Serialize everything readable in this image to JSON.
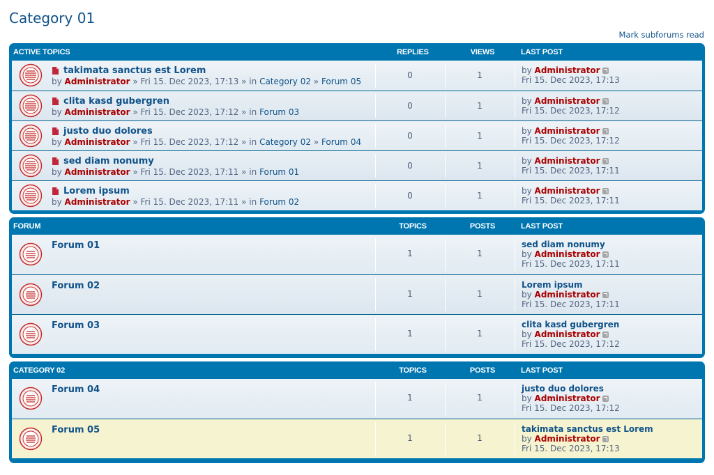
{
  "page": {
    "title": "Category 01",
    "mark_read": "Mark subforums read"
  },
  "active": {
    "header": {
      "title": "ACTIVE TOPICS",
      "col1": "REPLIES",
      "col2": "VIEWS",
      "col3": "LAST POST"
    },
    "rows": [
      {
        "title": "takimata sanctus est Lorem",
        "by": "by",
        "author": "Administrator",
        "sep": "»",
        "date": "Fri 15. Dec 2023, 17:13",
        "in": "» in",
        "path": [
          "Category 02",
          "Forum 05"
        ],
        "replies": "0",
        "views": "1",
        "lp_by": "by",
        "lp_author": "Administrator",
        "lp_date": "Fri 15. Dec 2023, 17:13"
      },
      {
        "title": "clita kasd gubergren",
        "by": "by",
        "author": "Administrator",
        "sep": "»",
        "date": "Fri 15. Dec 2023, 17:12",
        "in": "» in",
        "path": [
          "Forum 03"
        ],
        "replies": "0",
        "views": "1",
        "lp_by": "by",
        "lp_author": "Administrator",
        "lp_date": "Fri 15. Dec 2023, 17:12"
      },
      {
        "title": "justo duo dolores",
        "by": "by",
        "author": "Administrator",
        "sep": "»",
        "date": "Fri 15. Dec 2023, 17:12",
        "in": "» in",
        "path": [
          "Category 02",
          "Forum 04"
        ],
        "replies": "0",
        "views": "1",
        "lp_by": "by",
        "lp_author": "Administrator",
        "lp_date": "Fri 15. Dec 2023, 17:12"
      },
      {
        "title": "sed diam nonumy",
        "by": "by",
        "author": "Administrator",
        "sep": "»",
        "date": "Fri 15. Dec 2023, 17:11",
        "in": "» in",
        "path": [
          "Forum 01"
        ],
        "replies": "0",
        "views": "1",
        "lp_by": "by",
        "lp_author": "Administrator",
        "lp_date": "Fri 15. Dec 2023, 17:11"
      },
      {
        "title": "Lorem ipsum",
        "by": "by",
        "author": "Administrator",
        "sep": "»",
        "date": "Fri 15. Dec 2023, 17:11",
        "in": "» in",
        "path": [
          "Forum 02"
        ],
        "replies": "0",
        "views": "1",
        "lp_by": "by",
        "lp_author": "Administrator",
        "lp_date": "Fri 15. Dec 2023, 17:11"
      }
    ]
  },
  "forum": {
    "header": {
      "title": "FORUM",
      "col1": "TOPICS",
      "col2": "POSTS",
      "col3": "LAST POST"
    },
    "rows": [
      {
        "name": "Forum 01",
        "topics": "1",
        "posts": "1",
        "lp_title": "sed diam nonumy",
        "lp_by": "by",
        "lp_author": "Administrator",
        "lp_date": "Fri 15. Dec 2023, 17:11"
      },
      {
        "name": "Forum 02",
        "topics": "1",
        "posts": "1",
        "lp_title": "Lorem ipsum",
        "lp_by": "by",
        "lp_author": "Administrator",
        "lp_date": "Fri 15. Dec 2023, 17:11"
      },
      {
        "name": "Forum 03",
        "topics": "1",
        "posts": "1",
        "lp_title": "clita kasd gubergren",
        "lp_by": "by",
        "lp_author": "Administrator",
        "lp_date": "Fri 15. Dec 2023, 17:12"
      }
    ]
  },
  "category2": {
    "header": {
      "title": "CATEGORY 02",
      "col1": "TOPICS",
      "col2": "POSTS",
      "col3": "LAST POST"
    },
    "rows": [
      {
        "name": "Forum 04",
        "topics": "1",
        "posts": "1",
        "lp_title": "justo duo dolores",
        "lp_by": "by",
        "lp_author": "Administrator",
        "lp_date": "Fri 15. Dec 2023, 17:12"
      },
      {
        "name": "Forum 05",
        "topics": "1",
        "posts": "1",
        "lp_title": "takimata sanctus est Lorem",
        "lp_by": "by",
        "lp_author": "Administrator",
        "lp_date": "Fri 15. Dec 2023, 17:13"
      }
    ]
  },
  "icons": {
    "topic": "topic-read-icon",
    "forum": "forum-read-icon",
    "doc": "sticky-doc-icon",
    "goto": "goto-last-post-icon"
  },
  "colors": {
    "header_blue": "#0076b1",
    "link": "#105289",
    "admin": "#aa0000",
    "highlight": "#f6f4d0"
  }
}
